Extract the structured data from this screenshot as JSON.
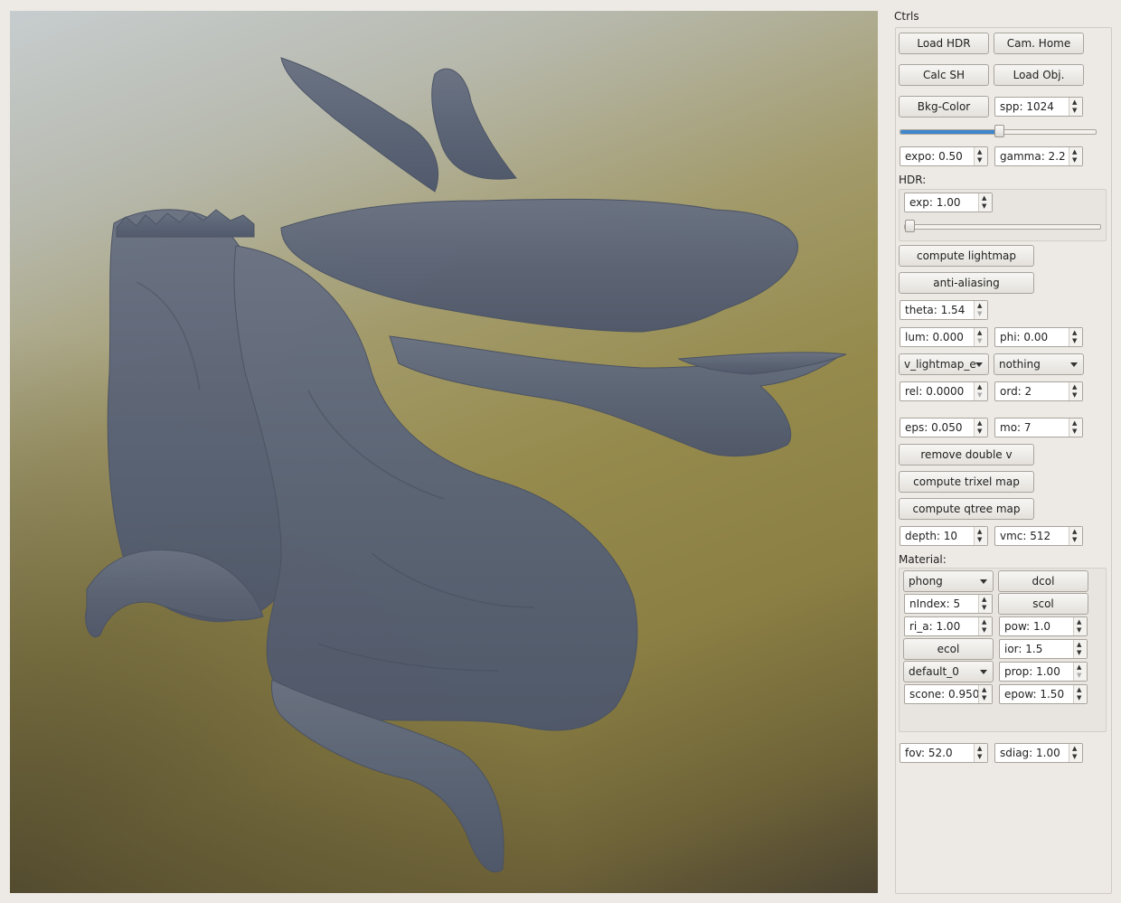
{
  "panel_title": "Ctrls",
  "buttons": {
    "load_hdr": "Load HDR",
    "cam_home": "Cam. Home",
    "calc_sh": "Calc SH",
    "load_obj": "Load Obj.",
    "bkg_color": "Bkg-Color",
    "compute_lightmap": "compute lightmap",
    "anti_aliasing": "anti-aliasing",
    "remove_double_v": "remove double v",
    "compute_trixel_map": "compute trixel map",
    "compute_qtree_map": "compute qtree map",
    "dcol": "dcol",
    "scol": "scol",
    "ecol": "ecol"
  },
  "spinboxes": {
    "spp": "spp: 1024",
    "expo": "expo: 0.50",
    "gamma": "gamma: 2.2",
    "hdr_exp": "exp: 1.00",
    "theta": "theta: 1.54",
    "lum": "lum: 0.000",
    "phi": "phi: 0.00",
    "rel": "rel: 0.0000",
    "ord": "ord: 2",
    "eps": "eps: 0.050",
    "mo": "mo: 7",
    "depth": "depth: 10",
    "vmc": "vmc: 512",
    "nindex": "nIndex: 5",
    "ri_a": "ri_a: 1.00",
    "pow": "pow: 1.0",
    "ior": "ior: 1.5",
    "prop": "prop: 1.00",
    "scone": "scone: 0.950",
    "epow": "epow: 1.50",
    "fov": "fov: 52.0",
    "sdiag": "sdiag: 1.00"
  },
  "combos": {
    "lightmap_mode": "v_lightmap_e",
    "secondary_mode": "nothing",
    "material_type": "phong",
    "material_name": "default_0"
  },
  "labels": {
    "hdr": "HDR:",
    "material": "Material:"
  },
  "sliders": {
    "spp_fraction": 0.5,
    "hdr_exp_fraction": 0.0
  },
  "colors": {
    "accent": "#3f86cd",
    "dragon": "#5a6478"
  }
}
